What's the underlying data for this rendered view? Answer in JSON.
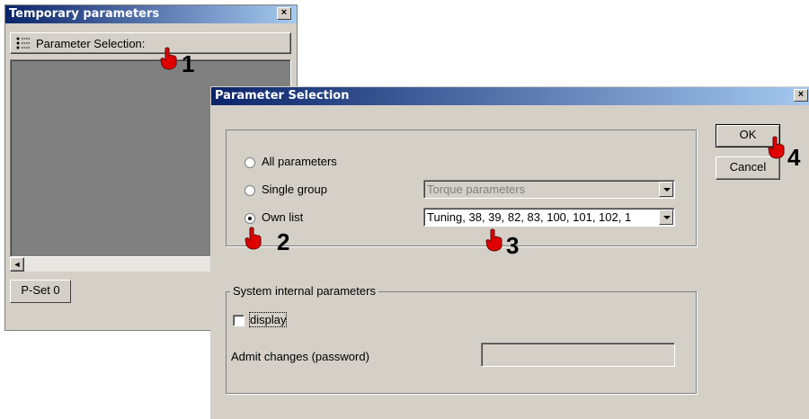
{
  "temp_window": {
    "title": "Temporary parameters",
    "close_glyph": "×",
    "toolbar_button_label": "Parameter Selection:",
    "toolbar_icon": "list-icon",
    "tab_label": "P-Set 0",
    "scroll_left_glyph": "◄"
  },
  "dialog": {
    "title": "Parameter Selection",
    "close_glyph": "×",
    "options": {
      "all_label": "All parameters",
      "single_label": "Single group",
      "own_label": "Own list",
      "selected": "Own list",
      "single_group_value": "Torque parameters",
      "own_list_value": "Tuning, 38, 39, 82, 83, 100, 101, 102, 1"
    },
    "system_group": {
      "legend": "System internal parameters",
      "display_label": "display",
      "display_checked": false,
      "password_label": "Admit changes (password)",
      "password_value": ""
    },
    "ok_label": "OK",
    "cancel_label": "Cancel"
  },
  "markers": {
    "m1": "1",
    "m2": "2",
    "m3": "3",
    "m4": "4"
  },
  "colors": {
    "titlebar_start": "#0a246a",
    "titlebar_end": "#a6caf0",
    "face": "#d4d0c8",
    "hand": "#e00000"
  }
}
